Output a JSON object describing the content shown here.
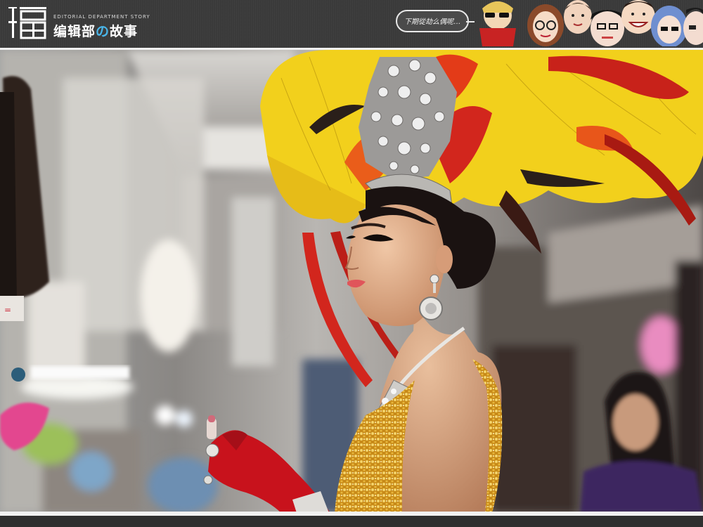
{
  "header": {
    "logo_glyph": "編",
    "subtitle": "EDITORIAL DEPARTMENT STORY",
    "title_part1": "编辑部",
    "title_no": "の",
    "title_part2": "故事",
    "bubble_text": "下期從劫么偶呢…"
  },
  "photo": {
    "subject": "showgirl-with-feather-headdress"
  },
  "colors": {
    "header_bg": "#3a3a3a",
    "accent_blue": "#49b6ea",
    "feather_yellow": "#f2d01c",
    "feather_red": "#d2261d",
    "dress_gold": "#d9a022",
    "glove_red": "#c8121c"
  }
}
